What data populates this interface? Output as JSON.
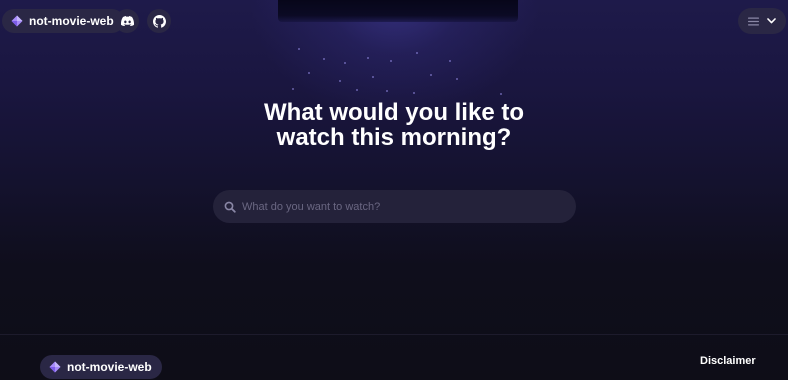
{
  "header": {
    "brand_name": "not-movie-web",
    "brand_icon": "diamond-logo-icon",
    "discord_icon": "discord-icon",
    "github_icon": "github-icon",
    "menu_icon": "hamburger-menu-icon",
    "menu_chevron_icon": "chevron-down-icon"
  },
  "hero": {
    "title_line1": "What would you like to",
    "title_line2": "watch this morning?"
  },
  "search": {
    "placeholder": "What do you want to watch?",
    "value": "",
    "icon": "search-icon"
  },
  "footer": {
    "brand_name": "not-movie-web",
    "disclaimer_label": "Disclaimer"
  },
  "colors": {
    "brand_accent": "#a78bfa",
    "pill_background": "#2a2745",
    "page_top": "#1e1a4a",
    "page_bottom": "#0e0d17"
  }
}
